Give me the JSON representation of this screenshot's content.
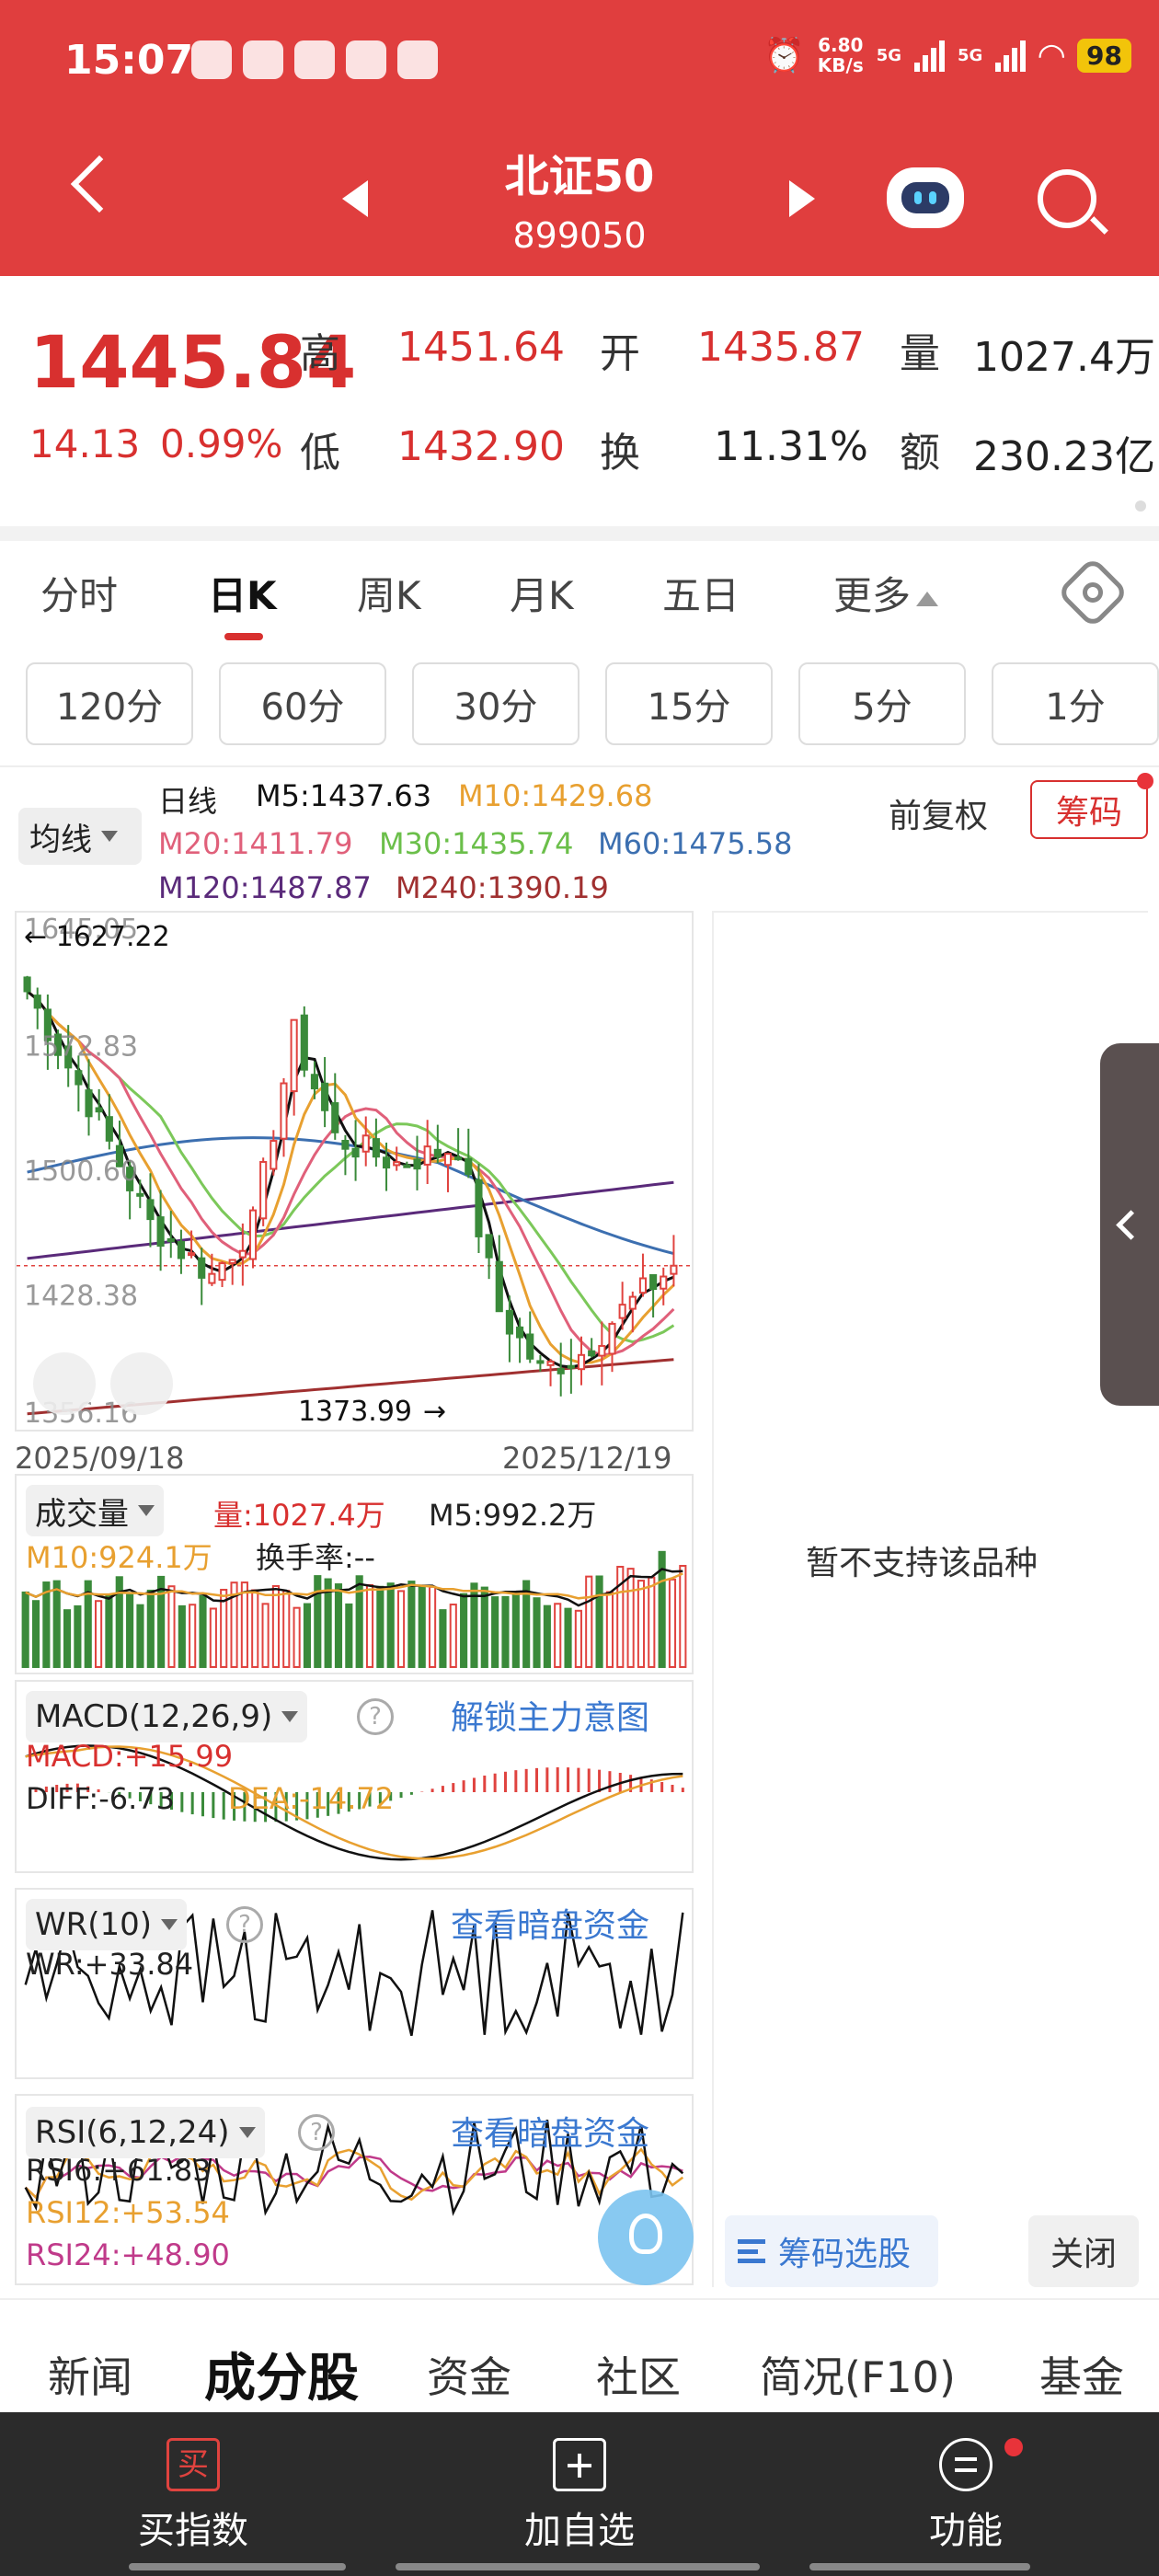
{
  "status_bar": {
    "time": "15:07",
    "speed_value": "6.80",
    "speed_unit": "KB/s",
    "net1": "5G",
    "net2": "5G",
    "battery": "98"
  },
  "header": {
    "title": "北证50",
    "code": "899050"
  },
  "quote": {
    "price": "1445.84",
    "change": "14.13",
    "change_pct": "0.99%",
    "high_label": "高",
    "high": "1451.64",
    "open_label": "开",
    "open": "1435.87",
    "volume_label": "量",
    "volume": "1027.4万",
    "low_label": "低",
    "low": "1432.90",
    "turnover_label": "换",
    "turnover": "11.31%",
    "amount_label": "额",
    "amount": "230.23亿"
  },
  "tabs": [
    {
      "label": "分时"
    },
    {
      "label": "日K"
    },
    {
      "label": "周K"
    },
    {
      "label": "月K"
    },
    {
      "label": "五日"
    },
    {
      "label": "更多"
    }
  ],
  "periods": [
    {
      "label": "120分"
    },
    {
      "label": "60分"
    },
    {
      "label": "30分"
    },
    {
      "label": "15分"
    },
    {
      "label": "5分"
    },
    {
      "label": "1分"
    }
  ],
  "chart": {
    "ma_select": "均线",
    "line_name": "日线",
    "m5": "M5:1437.63",
    "m10": "M10:1429.68",
    "m20": "M20:1411.79",
    "m30": "M30:1435.74",
    "m60": "M60:1475.58",
    "m120": "M120:1487.87",
    "m240": "M240:1390.19",
    "adjust": "前复权",
    "chouma": "筹码",
    "arrow_left": "←",
    "arrow_right": "→",
    "hi_label": "1627.22",
    "lo_label": "1373.99",
    "y_top": "1645.05",
    "y_2": "1572.83",
    "y_3": "1500.60",
    "y_4": "1428.38",
    "y_bottom": "1356.16",
    "date_start": "2025/09/18",
    "date_end": "2025/12/19",
    "not_supported": "暂不支持该品种",
    "colors": {
      "up": "#e0433f",
      "down": "#3a8a3a",
      "m5": "#111111",
      "m10": "#e8a030",
      "m20": "#e0607a",
      "m30": "#7cc85a",
      "m60": "#3c6fb0",
      "m120": "#5a2a7a",
      "m240": "#a03030"
    }
  },
  "volume": {
    "select": "成交量",
    "vol": "量:1027.4万",
    "m5": "M5:992.2万",
    "m10": "M10:924.1万",
    "turnover": "换手率:--"
  },
  "macd": {
    "select": "MACD(12,26,9)",
    "link": "解锁主力意图",
    "macd": "MACD:+15.99",
    "diff": "DIFF:-6.73",
    "dea": "DEA:-14.72"
  },
  "wr": {
    "select": "WR(10)",
    "link": "查看暗盘资金",
    "wr": "WR:+33.84"
  },
  "rsi": {
    "select": "RSI(6,12,24)",
    "link": "查看暗盘资金",
    "rsi6": "RSI6:+61.83",
    "rsi12": "RSI12:+53.54",
    "rsi24": "RSI24:+48.90"
  },
  "chip_button": "筹码选股",
  "close_button": "关闭",
  "bottom_tabs": [
    {
      "label": "新闻"
    },
    {
      "label": "成分股"
    },
    {
      "label": "资金"
    },
    {
      "label": "社区"
    },
    {
      "label": "简况(F10)"
    },
    {
      "label": "基金"
    }
  ],
  "bottom_bar": {
    "buy_icon": "买",
    "buy": "买指数",
    "add": "加自选",
    "func": "功能"
  },
  "chart_data": {
    "type": "candlestick",
    "date_range": [
      "2025/09/18",
      "2025/12/19"
    ],
    "ylim": [
      1356.16,
      1645.05
    ],
    "y_ticks": [
      1645.05,
      1572.83,
      1500.6,
      1428.38,
      1356.16
    ],
    "annotations": {
      "high": 1627.22,
      "low": 1373.99
    },
    "last": {
      "close": 1445.84,
      "high": 1451.64,
      "open": 1435.87,
      "low": 1432.9
    },
    "ma": {
      "M5": 1437.63,
      "M10": 1429.68,
      "M20": 1411.79,
      "M30": 1435.74,
      "M60": 1475.58,
      "M120": 1487.87,
      "M240": 1390.19
    }
  }
}
